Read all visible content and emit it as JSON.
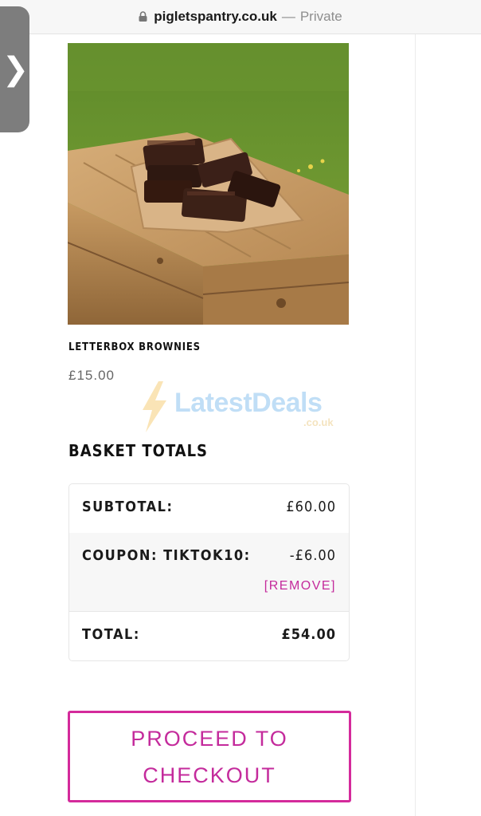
{
  "browser": {
    "domain": "pigletspantry.co.uk",
    "separator": "—",
    "mode": "Private"
  },
  "product": {
    "name": "LETTERBOX BROWNIES",
    "price": "£15.00"
  },
  "watermark": {
    "text": "LatestDeals",
    "sub": ".co.uk"
  },
  "basket": {
    "heading": "BASKET TOTALS",
    "subtotal_label": "SUBTOTAL:",
    "subtotal_value": "£60.00",
    "coupon_label": "COUPON: TIKTOK10:",
    "coupon_value": "-£6.00",
    "remove_label": "[REMOVE]",
    "total_label": "TOTAL:",
    "total_value": "£54.00"
  },
  "checkout_label": "PROCEED TO CHECKOUT",
  "colors": {
    "accent": "#c42b9c",
    "border": "#e6e6e6"
  },
  "icons": {
    "lock": "lock-icon",
    "sidebar_toggle": "chevron-right-icon"
  }
}
